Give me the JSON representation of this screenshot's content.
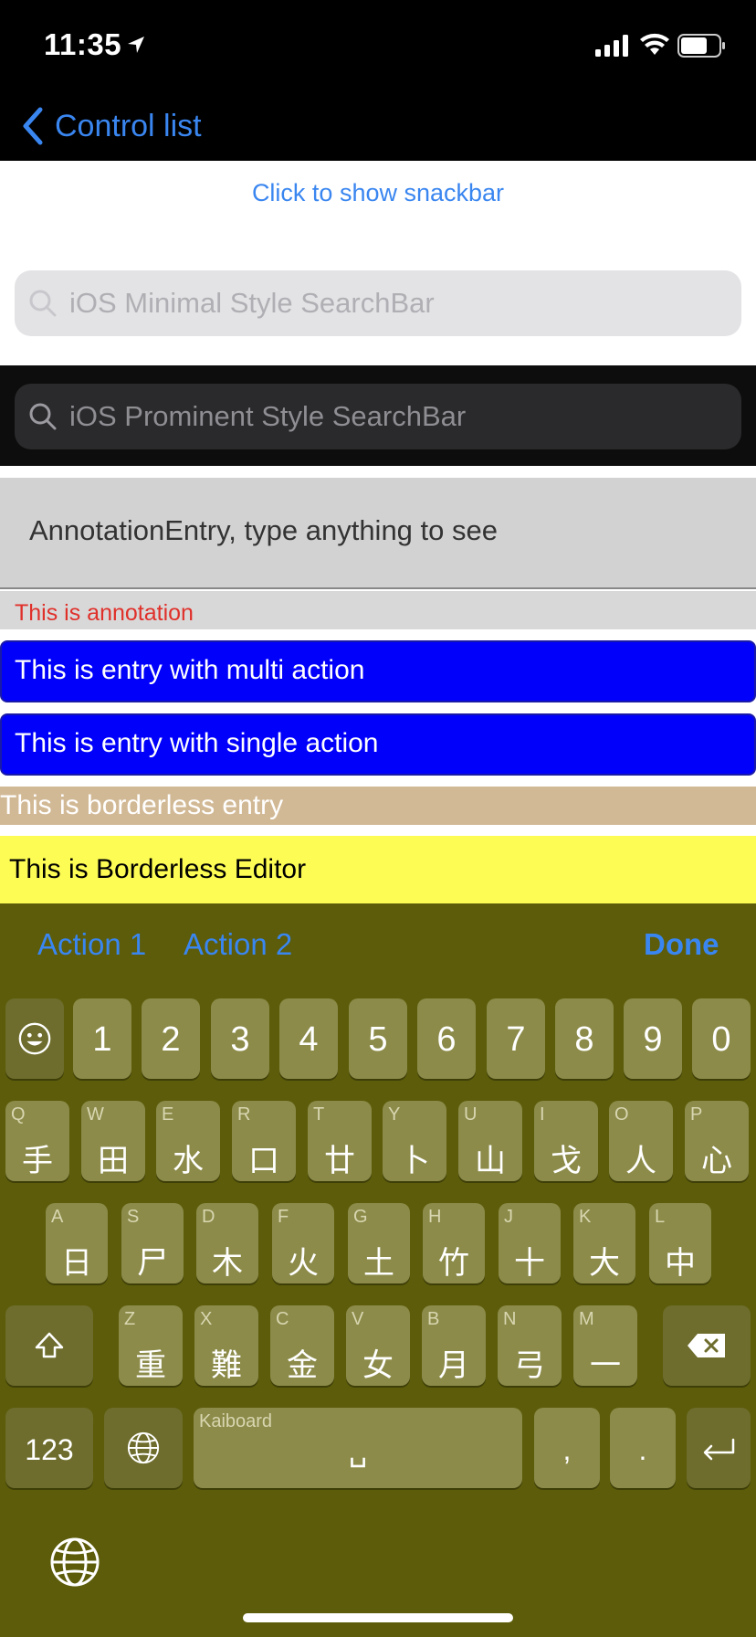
{
  "status": {
    "time": "11:35"
  },
  "nav": {
    "back_label": "Control list"
  },
  "snackbar": {
    "label": "Click to show snackbar"
  },
  "search_minimal": {
    "placeholder": "iOS Minimal Style SearchBar"
  },
  "search_prominent": {
    "placeholder": "iOS Prominent Style SearchBar"
  },
  "annotation_entry": {
    "placeholder": "AnnotationEntry, type anything to see",
    "annotation": "This is annotation"
  },
  "multi_action_entry": {
    "placeholder": "This is entry with multi action"
  },
  "single_action_entry": {
    "placeholder": "This is entry with single action"
  },
  "borderless_entry": {
    "placeholder": "This is borderless entry"
  },
  "borderless_editor": {
    "value": "This is Borderless Editor"
  },
  "keyboard_toolbar": {
    "action1": "Action 1",
    "action2": "Action 2",
    "done": "Done"
  },
  "keyboard": {
    "numbers": [
      "1",
      "2",
      "3",
      "4",
      "5",
      "6",
      "7",
      "8",
      "9",
      "0"
    ],
    "row1": [
      {
        "latin": "Q",
        "char": "手"
      },
      {
        "latin": "W",
        "char": "田"
      },
      {
        "latin": "E",
        "char": "水"
      },
      {
        "latin": "R",
        "char": "口"
      },
      {
        "latin": "T",
        "char": "廿"
      },
      {
        "latin": "Y",
        "char": "卜"
      },
      {
        "latin": "U",
        "char": "山"
      },
      {
        "latin": "I",
        "char": "戈"
      },
      {
        "latin": "O",
        "char": "人"
      },
      {
        "latin": "P",
        "char": "心"
      }
    ],
    "row2": [
      {
        "latin": "A",
        "char": "日"
      },
      {
        "latin": "S",
        "char": "尸"
      },
      {
        "latin": "D",
        "char": "木"
      },
      {
        "latin": "F",
        "char": "火"
      },
      {
        "latin": "G",
        "char": "土"
      },
      {
        "latin": "H",
        "char": "竹"
      },
      {
        "latin": "J",
        "char": "十"
      },
      {
        "latin": "K",
        "char": "大"
      },
      {
        "latin": "L",
        "char": "中"
      }
    ],
    "row3": [
      {
        "latin": "Z",
        "char": "重"
      },
      {
        "latin": "X",
        "char": "難"
      },
      {
        "latin": "C",
        "char": "金"
      },
      {
        "latin": "V",
        "char": "女"
      },
      {
        "latin": "B",
        "char": "月"
      },
      {
        "latin": "N",
        "char": "弓"
      },
      {
        "latin": "M",
        "char": "一"
      }
    ],
    "numbers_key": "123",
    "space_hint": "Kaiboard",
    "space_symbol": "␣",
    "comma": ",",
    "period": "."
  }
}
